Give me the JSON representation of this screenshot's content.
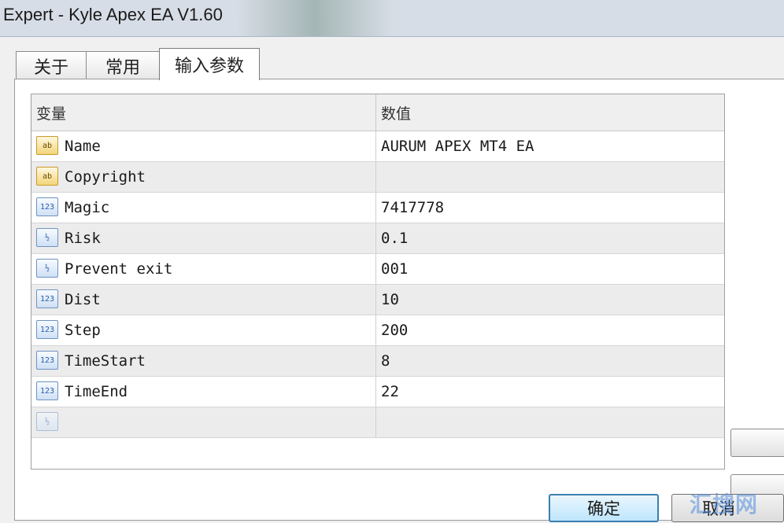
{
  "window": {
    "title": "Expert - Kyle Apex EA V1.60"
  },
  "tabs": [
    {
      "label": "关于",
      "active": false
    },
    {
      "label": "常用",
      "active": false
    },
    {
      "label": "输入参数",
      "active": true
    }
  ],
  "grid": {
    "columns": [
      "变量",
      "数值"
    ],
    "rows": [
      {
        "icon": "text-type-icon",
        "name": "Name",
        "value": "AURUM APEX MT4 EA"
      },
      {
        "icon": "text-type-icon",
        "name": "Copyright",
        "value": ""
      },
      {
        "icon": "integer-type-icon",
        "name": "Magic",
        "value": "7417778"
      },
      {
        "icon": "double-type-icon",
        "name": "Risk",
        "value": "0.1"
      },
      {
        "icon": "double-type-icon",
        "name": "Prevent exit",
        "value": "001"
      },
      {
        "icon": "integer-type-icon",
        "name": "Dist",
        "value": "10"
      },
      {
        "icon": "integer-type-icon",
        "name": "Step",
        "value": "200"
      },
      {
        "icon": "integer-type-icon",
        "name": "TimeStart",
        "value": "8"
      },
      {
        "icon": "integer-type-icon",
        "name": "TimeEnd",
        "value": "22"
      },
      {
        "icon": "double-type-icon",
        "name": "",
        "value": ""
      }
    ]
  },
  "buttons": {
    "ok": "确定",
    "cancel": "取消"
  },
  "watermark": "汇搜网",
  "colors": {
    "ok_border": "#3c7fb1",
    "row_alt": "#ececec",
    "titlebar": "#d7dde6"
  }
}
